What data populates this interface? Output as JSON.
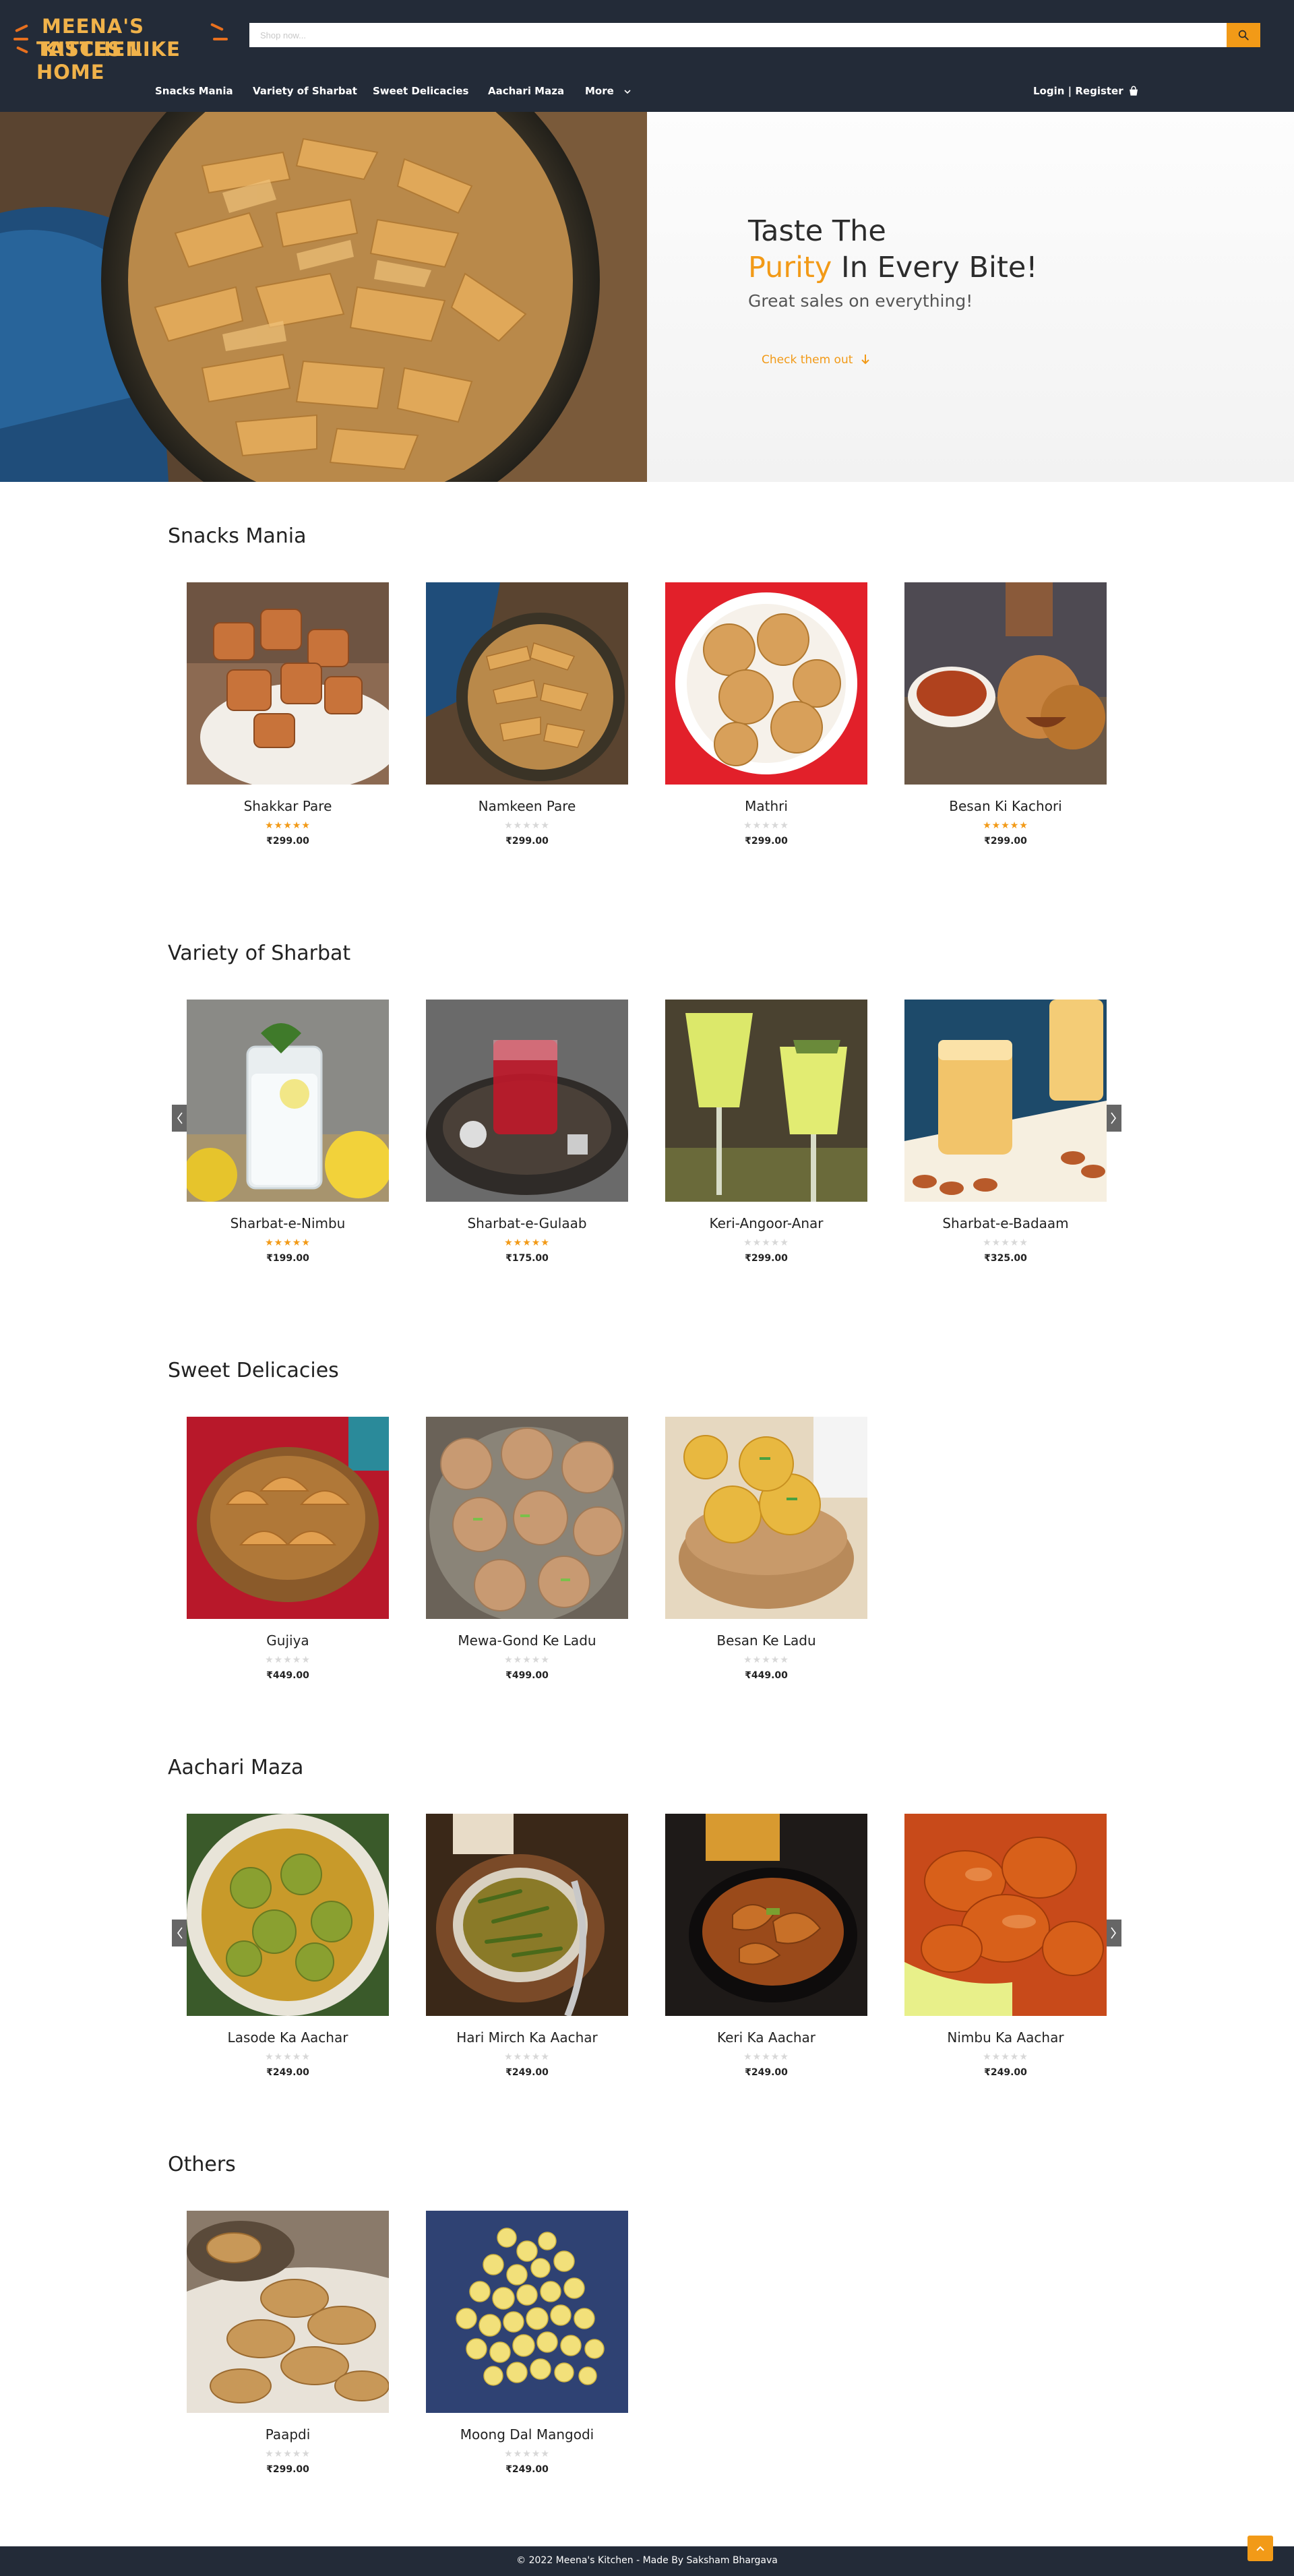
{
  "brand": {
    "logo_line1": "MEENA'S KITCHEN",
    "logo_line2": "TASTES LIKE HOME"
  },
  "search": {
    "placeholder": "Shop now...",
    "value": ""
  },
  "nav": {
    "items": [
      {
        "label": "Snacks Mania"
      },
      {
        "label": "Variety of Sharbat"
      },
      {
        "label": "Sweet Delicacies"
      },
      {
        "label": "Aachari Maza"
      },
      {
        "label": "More"
      }
    ],
    "login": "Login",
    "separator": " | ",
    "register": "Register"
  },
  "hero": {
    "line1": "Taste The",
    "line2_accent": "Purity",
    "line2_rest": " In Every Bite!",
    "subtitle": "Great sales on everything!",
    "cta": "Check them out"
  },
  "colors": {
    "header_bg": "#232b38",
    "accent": "#f29a17",
    "star_empty": "#d8d8d8"
  },
  "sections": [
    {
      "title": "Snacks Mania",
      "has_arrows": false,
      "products": [
        {
          "name": "Shakkar Pare",
          "rating": 5,
          "price": "₹299.00"
        },
        {
          "name": "Namkeen Pare",
          "rating": 0,
          "price": "₹299.00"
        },
        {
          "name": "Mathri",
          "rating": 0,
          "price": "₹299.00"
        },
        {
          "name": "Besan Ki Kachori",
          "rating": 5,
          "price": "₹299.00"
        }
      ]
    },
    {
      "title": "Variety of Sharbat",
      "has_arrows": true,
      "products": [
        {
          "name": "Sharbat-e-Nimbu",
          "rating": 5,
          "price": "₹199.00"
        },
        {
          "name": "Sharbat-e-Gulaab",
          "rating": 5,
          "price": "₹175.00"
        },
        {
          "name": "Keri-Angoor-Anar",
          "rating": 0,
          "price": "₹299.00"
        },
        {
          "name": "Sharbat-e-Badaam",
          "rating": 0,
          "price": "₹325.00"
        }
      ]
    },
    {
      "title": "Sweet Delicacies",
      "has_arrows": false,
      "products": [
        {
          "name": "Gujiya",
          "rating": 0,
          "price": "₹449.00"
        },
        {
          "name": "Mewa-Gond Ke Ladu",
          "rating": 0,
          "price": "₹499.00"
        },
        {
          "name": "Besan Ke Ladu",
          "rating": 0,
          "price": "₹449.00"
        }
      ]
    },
    {
      "title": "Aachari Maza",
      "has_arrows": true,
      "products": [
        {
          "name": "Lasode Ka Aachar",
          "rating": 0,
          "price": "₹249.00"
        },
        {
          "name": "Hari Mirch Ka Aachar",
          "rating": 0,
          "price": "₹249.00"
        },
        {
          "name": "Keri Ka Aachar",
          "rating": 0,
          "price": "₹249.00"
        },
        {
          "name": "Nimbu Ka Aachar",
          "rating": 0,
          "price": "₹249.00"
        }
      ]
    },
    {
      "title": "Others",
      "has_arrows": false,
      "products": [
        {
          "name": "Paapdi",
          "rating": 0,
          "price": "₹299.00"
        },
        {
          "name": "Moong Dal Mangodi",
          "rating": 0,
          "price": "₹249.00"
        }
      ]
    }
  ],
  "footer": {
    "text": "© 2022 Meena's Kitchen - Made By Saksham Bhargava"
  }
}
